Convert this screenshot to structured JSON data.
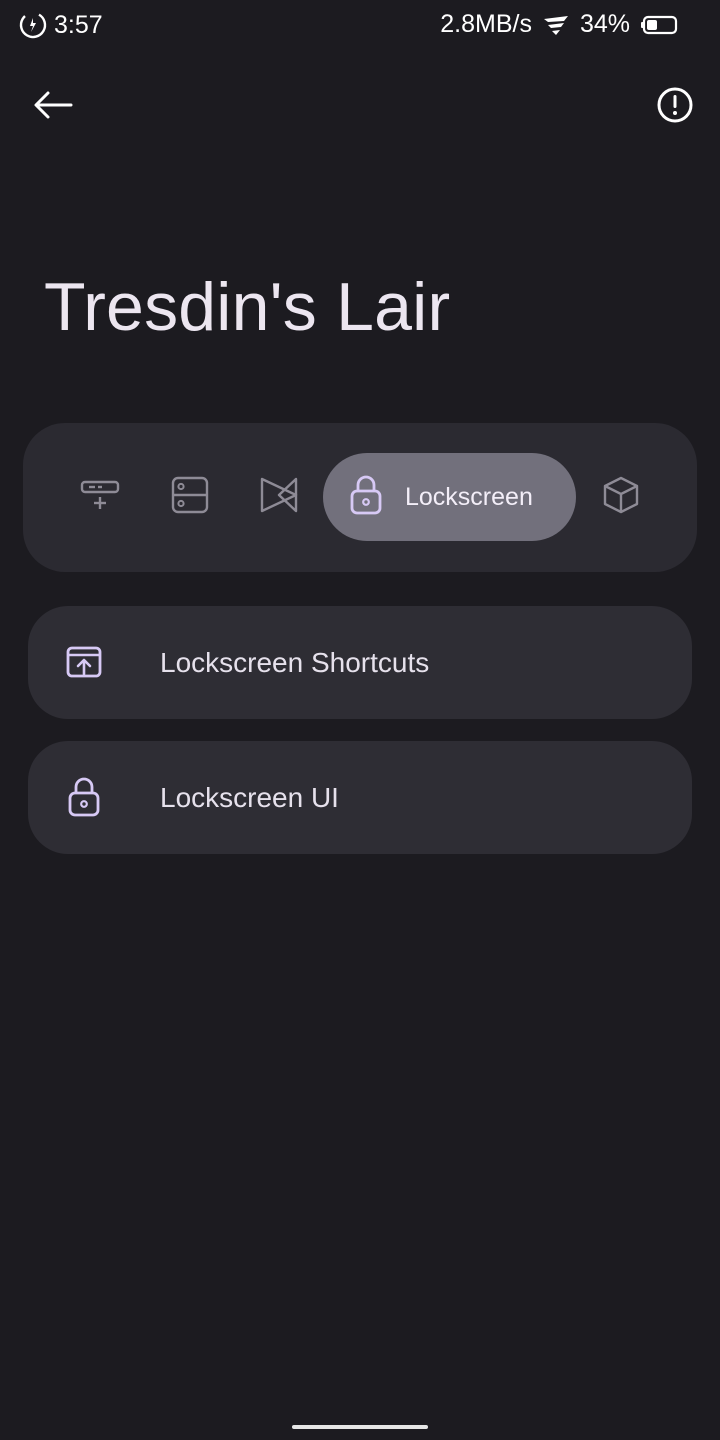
{
  "status_bar": {
    "time": "3:57",
    "network_speed": "2.8MB/s",
    "battery_percent": "34%",
    "battery_level": 0.34,
    "icons": [
      "data-saver-icon",
      "wifi-icon",
      "battery-icon"
    ]
  },
  "app_bar": {
    "back_icon": "arrow-back-icon",
    "info_icon": "info-icon"
  },
  "page": {
    "title": "Tresdin's Lair"
  },
  "tabs": [
    {
      "icon": "add-panel-icon",
      "label": "",
      "selected": false
    },
    {
      "icon": "storage-icon",
      "label": "",
      "selected": false
    },
    {
      "icon": "media-player-icon",
      "label": "",
      "selected": false
    },
    {
      "icon": "lock-icon",
      "label": "Lockscreen",
      "selected": true
    },
    {
      "icon": "cube-icon",
      "label": "",
      "selected": false
    }
  ],
  "list": [
    {
      "icon": "shortcut-upload-icon",
      "label": "Lockscreen Shortcuts"
    },
    {
      "icon": "lock-icon",
      "label": "Lockscreen UI"
    }
  ],
  "colors": {
    "background": "#1c1b20",
    "surface": "#2e2d34",
    "tab_strip": "#2b2a31",
    "selected_tab": "#72707c",
    "accent_icon": "#d7c9f5",
    "text": "#e6e1ec"
  }
}
